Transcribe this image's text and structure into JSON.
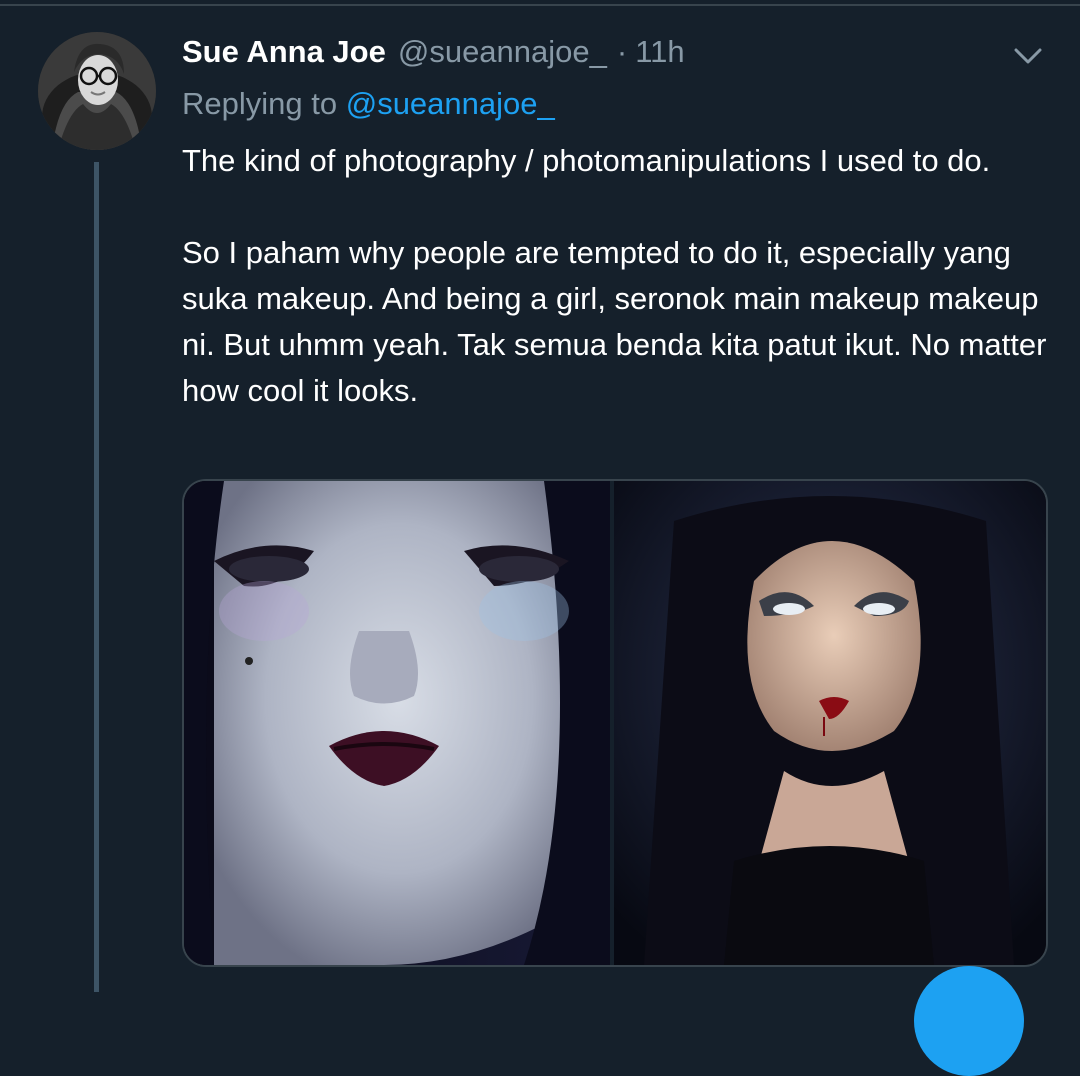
{
  "tweet": {
    "author_name": "Sue Anna Joe",
    "handle": "@sueannajoe_",
    "separator": "·",
    "time": "11h",
    "replying_prefix": "Replying to",
    "replying_to": "@sueannajoe_",
    "paragraphs": [
      "The kind of photography / photomanipulations I used to do.",
      "So I paham why people are tempted to do it, especially yang suka makeup. And being a girl, seronok main makeup makeup ni. But uhmm yeah. Tak semua benda kita patut ikut. No matter how cool it looks."
    ]
  },
  "icons": {
    "menu": "chevron-down-icon",
    "compose": "compose-fab"
  },
  "colors": {
    "background": "#15202b",
    "text": "#ffffff",
    "secondary": "#8899a6",
    "accent": "#1da1f2",
    "thread_line": "#3d5466"
  }
}
